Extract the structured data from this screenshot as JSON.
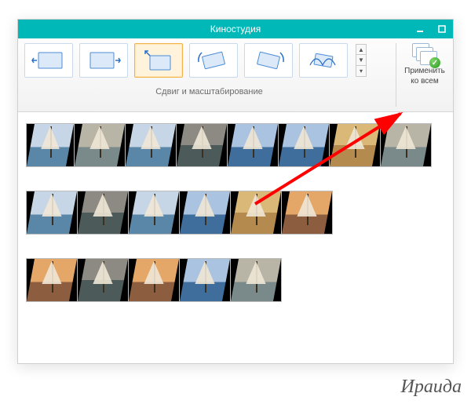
{
  "window": {
    "title": "Киностудия"
  },
  "ribbon": {
    "gallery_label": "Сдвиг и масштабирование",
    "apply_label_l1": "Применить",
    "apply_label_l2": "ко всем",
    "effects": [
      {
        "name": "pan-left"
      },
      {
        "name": "pan-right"
      },
      {
        "name": "zoom-in-top",
        "selected": true
      },
      {
        "name": "tilt-left"
      },
      {
        "name": "tilt-right"
      },
      {
        "name": "rotate-bounce"
      }
    ]
  },
  "timeline": {
    "rows": [
      {
        "clips": [
          {
            "w": 62,
            "cls": "sea"
          },
          {
            "w": 66,
            "cls": "fog"
          },
          {
            "w": 66,
            "cls": "sea"
          },
          {
            "w": 66,
            "cls": "storm"
          },
          {
            "w": 66,
            "cls": "blue"
          },
          {
            "w": 66,
            "cls": "blue"
          },
          {
            "w": 66,
            "cls": "gold"
          },
          {
            "w": 66,
            "cls": "fog"
          }
        ]
      },
      {
        "clips": [
          {
            "w": 66,
            "cls": "sea"
          },
          {
            "w": 66,
            "cls": "storm"
          },
          {
            "w": 66,
            "cls": "sea"
          },
          {
            "w": 66,
            "cls": "blue"
          },
          {
            "w": 66,
            "cls": "gold"
          },
          {
            "w": 66,
            "cls": "sunset"
          }
        ]
      },
      {
        "clips": [
          {
            "w": 66,
            "cls": "sunset"
          },
          {
            "w": 66,
            "cls": "storm"
          },
          {
            "w": 66,
            "cls": "sunset"
          },
          {
            "w": 66,
            "cls": "blue"
          },
          {
            "w": 66,
            "cls": "fog"
          }
        ]
      }
    ]
  },
  "signature": "Ираида"
}
